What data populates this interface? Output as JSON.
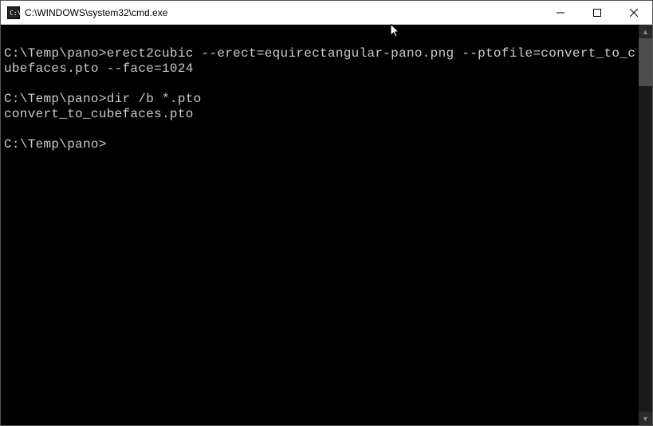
{
  "window": {
    "title": "C:\\WINDOWS\\system32\\cmd.exe",
    "icon_label": "cmd-icon"
  },
  "terminal": {
    "lines": [
      "",
      "C:\\Temp\\pano>erect2cubic --erect=equirectangular-pano.png --ptofile=convert_to_cubefaces.pto --face=1024",
      "",
      "C:\\Temp\\pano>dir /b *.pto",
      "convert_to_cubefaces.pto",
      "",
      "C:\\Temp\\pano>"
    ]
  },
  "colors": {
    "terminal_bg": "#000000",
    "terminal_fg": "#cccccc",
    "titlebar_bg": "#ffffff"
  }
}
